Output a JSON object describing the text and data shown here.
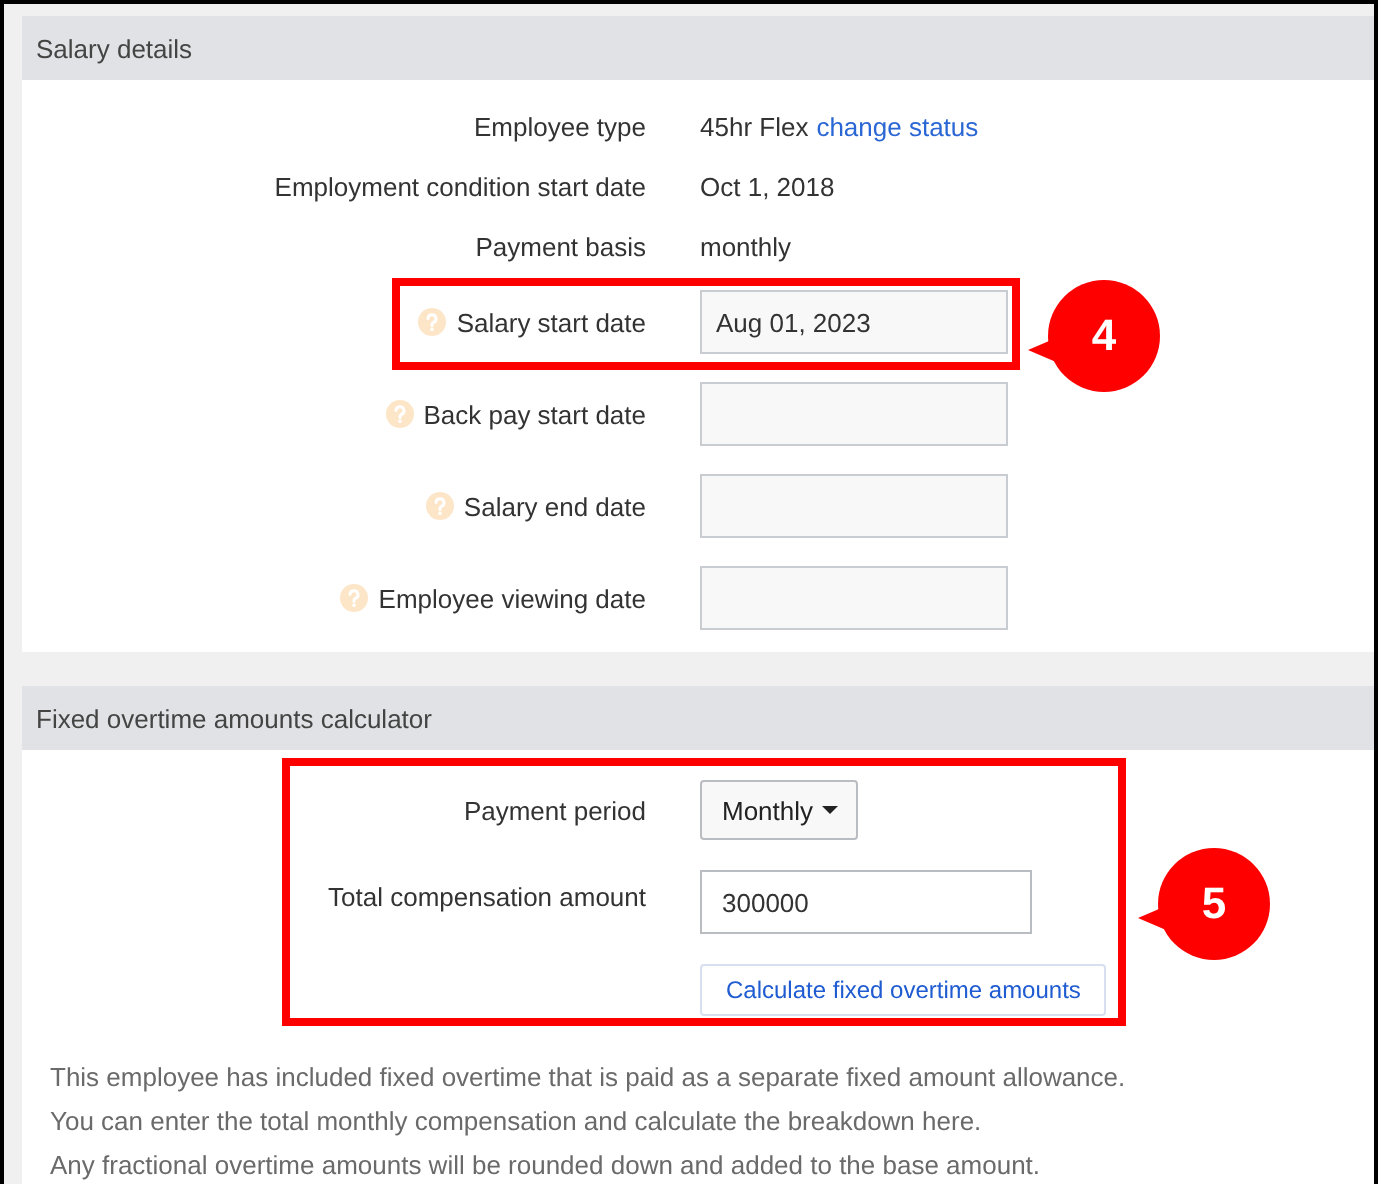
{
  "sections": [
    {
      "title": "Salary details",
      "rows": [
        {
          "kind": "text",
          "help": false,
          "label": "Employee type",
          "value": "45hr Flex",
          "link": "change status"
        },
        {
          "kind": "text",
          "help": false,
          "label": "Employment condition start date",
          "value": "Oct 1, 2018"
        },
        {
          "kind": "text",
          "help": false,
          "label": "Payment basis",
          "value": "monthly"
        },
        {
          "kind": "date",
          "help": true,
          "label": "Salary start date",
          "value": "Aug 01, 2023",
          "callout": "4"
        },
        {
          "kind": "date",
          "help": true,
          "label": "Back pay start date"
        },
        {
          "kind": "date",
          "help": true,
          "label": "Salary end date"
        },
        {
          "kind": "date",
          "help": true,
          "label": "Employee viewing date"
        }
      ]
    },
    {
      "title": "Fixed overtime amounts calculator",
      "callout": "5",
      "rows": [
        {
          "kind": "dropdown",
          "help": false,
          "label": "Payment period",
          "value": "Monthly"
        },
        {
          "kind": "input",
          "help": false,
          "label": "Total compensation amount",
          "value": "300000"
        },
        {
          "kind": "button",
          "help": false,
          "label": "Calculate fixed overtime amounts"
        }
      ],
      "notes": [
        "This employee has included fixed overtime that is paid as a separate fixed amount allowance.",
        "You can enter the total monthly compensation and calculate the breakdown here.",
        "Any fractional overtime amounts will be rounded down and added to the base amount."
      ]
    }
  ]
}
